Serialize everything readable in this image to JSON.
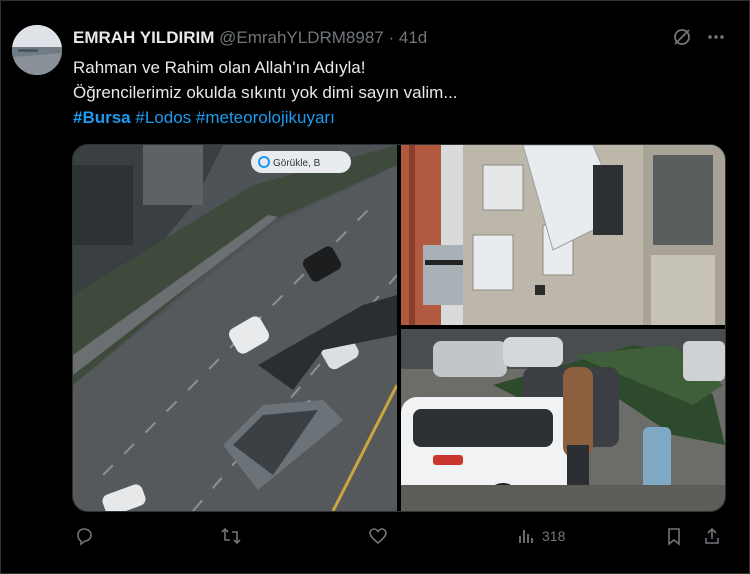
{
  "tweet": {
    "author_name": "EMRAH YILDIRIM",
    "author_handle": "@EmrahYLDRM8987",
    "separator": "·",
    "time": "41d",
    "text_line1": "Rahman ve Rahim olan Allah'ın Adıyla!",
    "text_line2": "Öğrencilerimiz okulda sıkıntı yok dimi sayın valim...",
    "hashtags": [
      "#Bursa",
      "#Lodos",
      "#meteorolojikuyarı"
    ]
  },
  "media": {
    "map_label": "Görükle, B"
  },
  "actions": {
    "views": "318"
  },
  "icons": {
    "reply": "reply-icon",
    "retweet": "retweet-icon",
    "like": "like-icon",
    "views": "views-icon",
    "bookmark": "bookmark-icon",
    "share": "share-icon",
    "grok": "grok-icon",
    "more": "more-icon"
  },
  "colors": {
    "background": "#000000",
    "text": "#e7e9ea",
    "muted": "#71767b",
    "link": "#1d9bf0"
  }
}
